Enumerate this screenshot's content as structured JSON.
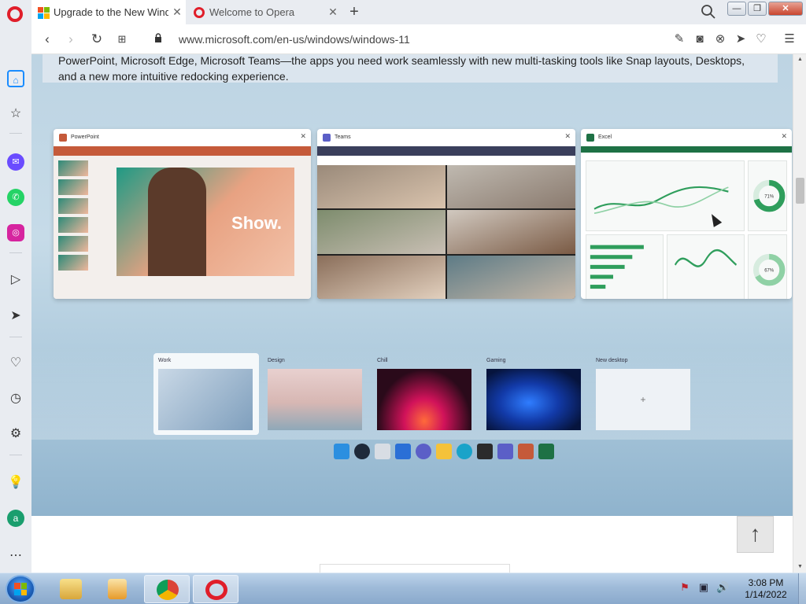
{
  "browser": {
    "tabs": [
      {
        "label": "Upgrade to the New Windows",
        "active": true
      },
      {
        "label": "Welcome to Opera",
        "active": false
      }
    ],
    "address": {
      "url": "www.microsoft.com/en-us/windows/windows-11"
    },
    "icons": {
      "back": "chevron-left-icon",
      "forward": "chevron-right-icon",
      "reload": "reload-icon",
      "tabs_grid": "grid-icon",
      "search": "search-icon"
    }
  },
  "page": {
    "intro_text": "PowerPoint, Microsoft Edge, Microsoft Teams—the apps you need work seamlessly with new multi-tasking tools like Snap layouts, Desktops, and a new more intuitive redocking experience.",
    "snap_windows": [
      {
        "title": "PowerPoint",
        "slide_text": "Show."
      },
      {
        "title": "Teams"
      },
      {
        "title": "Excel",
        "gauge1": "71%",
        "gauge2": "67%"
      }
    ],
    "desktops": [
      {
        "label": "Work"
      },
      {
        "label": "Design"
      },
      {
        "label": "Chill"
      },
      {
        "label": "Gaming"
      },
      {
        "label": "New desktop",
        "plus": "+"
      }
    ]
  },
  "scroll_top": {
    "label": "↑"
  },
  "taskbar": {
    "clock_time": "3:08 PM",
    "clock_date": "1/14/2022"
  },
  "colors": {
    "opera_red": "#e01e2a",
    "win7_taskbar": "#9fbbd9"
  }
}
